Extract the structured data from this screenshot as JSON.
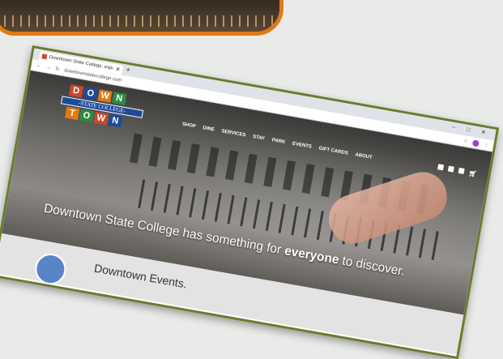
{
  "browser": {
    "tab_title": "Downtown State College, experi...",
    "new_tab": "+",
    "url": "downtownstatecollege.com",
    "window_controls": "– □ ✕"
  },
  "logo": {
    "top_letters": [
      "D",
      "O",
      "W",
      "N"
    ],
    "ribbon": "-STATE COLLEGE-",
    "bottom_letters": [
      "T",
      "O",
      "W",
      "N"
    ],
    "colors": [
      "#c9492e",
      "#1e4a9a",
      "#e07a16",
      "#2a8c3f"
    ]
  },
  "nav": [
    "SHOP",
    "DINE",
    "SERVICES",
    "STAY",
    "PARK",
    "EVENTS",
    "GIFT CARDS",
    "ABOUT"
  ],
  "hero": {
    "tagline_pre": "Downtown State College has something for ",
    "tagline_bold": "everyone",
    "tagline_post": " to discover."
  },
  "section": {
    "heading": "Downtown Events."
  }
}
